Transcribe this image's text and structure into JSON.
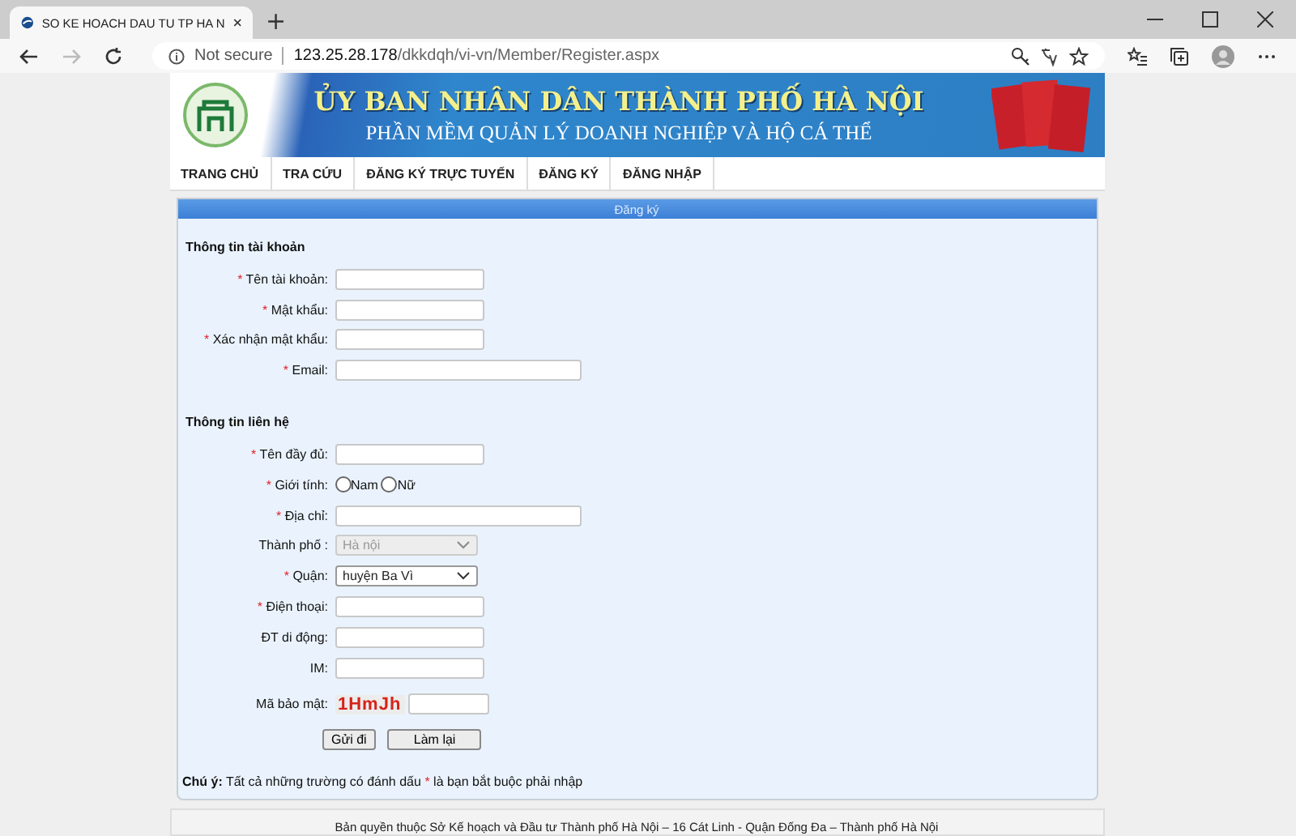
{
  "browser": {
    "tab_title": "SO KE HOACH DAU TU TP HA N",
    "new_tab": "+",
    "security": "Not secure",
    "host": "123.25.28.178",
    "path": "/dkkdqh/vi-vn/Member/Register.aspx"
  },
  "banner": {
    "title": "ỦY BAN NHÂN DÂN THÀNH PHỐ HÀ NỘI",
    "subtitle": "PHẦN MỀM QUẢN LÝ DOANH NGHIỆP VÀ HỘ CÁ THỂ"
  },
  "nav": [
    {
      "label": "TRANG CHỦ"
    },
    {
      "label": "TRA CỨU"
    },
    {
      "label": "ĐĂNG KÝ TRỰC TUYẾN"
    },
    {
      "label": "ĐĂNG KÝ"
    },
    {
      "label": "ĐĂNG NHẬP"
    }
  ],
  "form": {
    "title": "Đăng ký",
    "sections": [
      {
        "heading": "Thông tin tài khoản",
        "fields": [
          {
            "kind": "text",
            "mark": "*",
            "label": "Tên tài khoản:"
          },
          {
            "kind": "text",
            "mark": "*",
            "label": "Mật khẩu:"
          },
          {
            "kind": "text",
            "mark": "*",
            "label": "Xác nhận mật khẩu:"
          },
          {
            "kind": "wide-text",
            "mark": "*",
            "label": "Email:"
          }
        ]
      },
      {
        "heading": "Thông tin liên hệ",
        "fields": [
          {
            "kind": "text",
            "mark": "*",
            "label": "Tên đầy đủ:"
          },
          {
            "kind": "radio",
            "mark": "*",
            "label": "Giới tính:",
            "options": [
              {
                "label": "Nam",
                "selected": false
              },
              {
                "label": "Nữ",
                "selected": false
              }
            ]
          },
          {
            "kind": "wide-text",
            "mark": "*",
            "label": "Địa chỉ:"
          },
          {
            "kind": "select",
            "label": "Thành phố :",
            "value": "Hà nội",
            "disabled": true
          },
          {
            "kind": "select",
            "mark": "*",
            "label": "Quận:",
            "value": "huyện Ba Vì",
            "disabled": false
          },
          {
            "kind": "text",
            "mark": "*",
            "label": "Điện thoại:"
          },
          {
            "kind": "text",
            "label": "ĐT di động:"
          },
          {
            "kind": "text",
            "label": "IM:"
          },
          {
            "kind": "captcha",
            "label": "Mã bảo mật:",
            "code": "1HmJh"
          }
        ]
      }
    ],
    "buttons": [
      "Gửi đi",
      "Làm lại"
    ],
    "note": {
      "before": "**Chú ý:** Tất cả những trường có đánh dấu",
      "mark": "*",
      "after": "là bạn bắt buộc phải nhập"
    }
  },
  "footer": "Bản quyền thuộc Sở Kế hoạch và Đầu tư Thành phố Hà Nội – 16 Cát Linh - Quận Đống Đa – Thành phố Hà Nội"
}
